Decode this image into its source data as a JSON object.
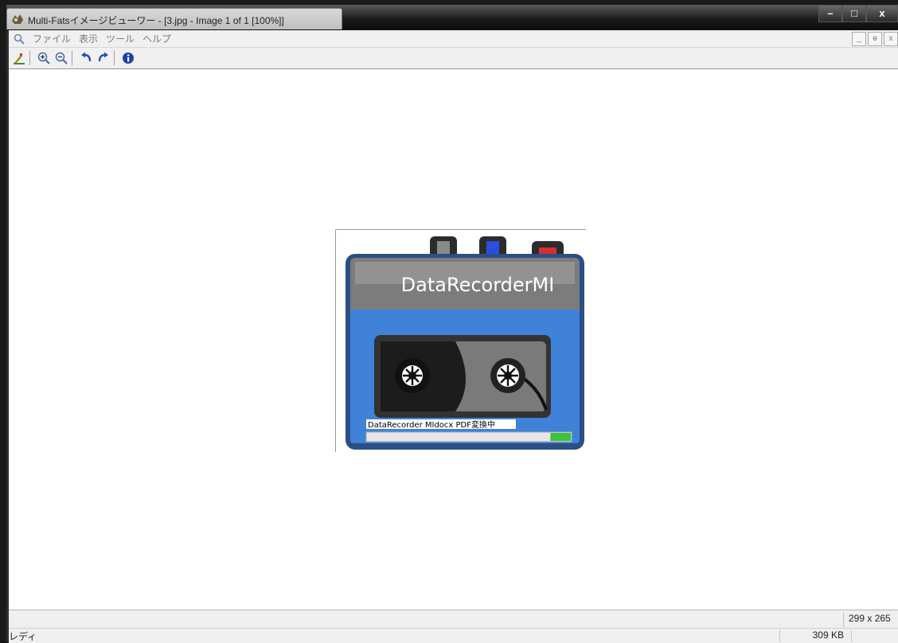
{
  "window": {
    "title": "Multi-Fatsイメージビューワー - [3.jpg - Image 1 of 1 [100%]]",
    "buttons": {
      "minimize": "–",
      "maximize": "□",
      "close": "x"
    }
  },
  "menu": {
    "items": [
      {
        "label": "ファイル"
      },
      {
        "label": "表示"
      },
      {
        "label": "ツール"
      },
      {
        "label": "ヘルプ"
      }
    ],
    "mdi": {
      "minimize": "_",
      "restore": "ɵ",
      "close": "x"
    }
  },
  "toolbar": {
    "icons": [
      "paint-icon",
      "zoom-in-icon",
      "zoom-out-icon",
      "rotate-left-icon",
      "rotate-right-icon",
      "info-icon"
    ]
  },
  "image": {
    "header_text": "DataRecorderMI",
    "caption": "DataRecorder MIdocx PDF変換中",
    "progress": 0.1
  },
  "status": {
    "dimensions": "299 x 265",
    "ready": "レディ",
    "file_size": "309 KB"
  },
  "colors": {
    "device_blue": "#3d7fd6",
    "device_gray": "#7f7f7f",
    "progress_green": "#3cc23c"
  }
}
